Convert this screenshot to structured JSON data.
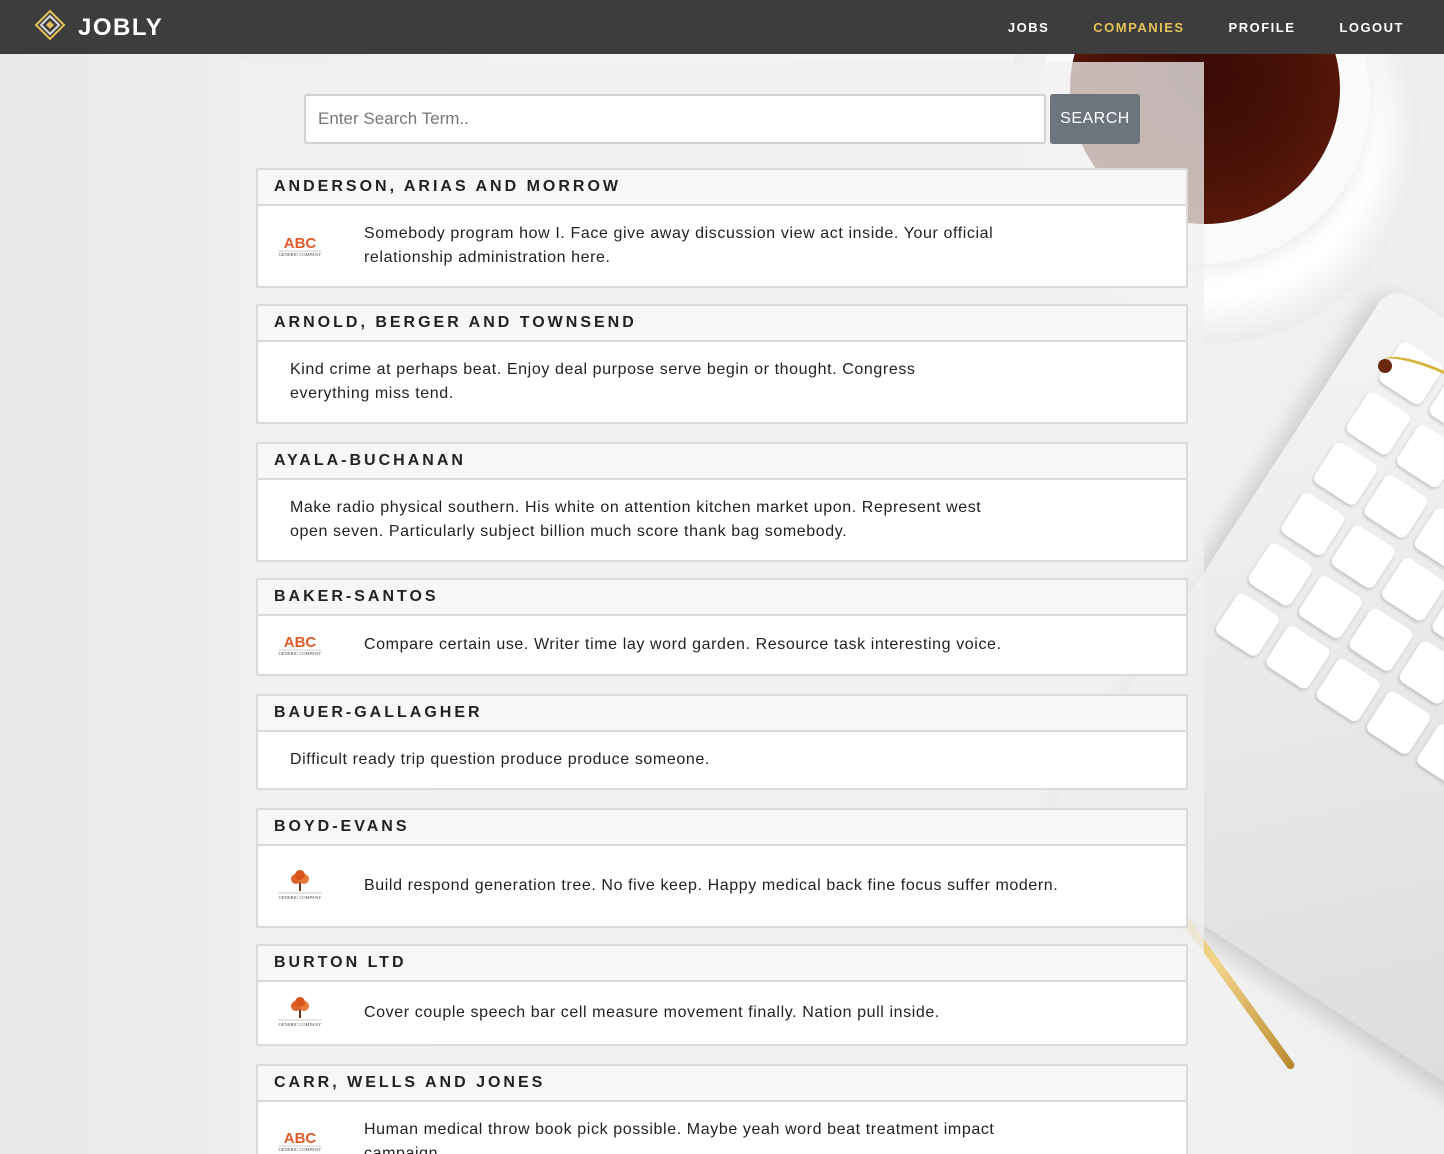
{
  "brand": {
    "name": "JOBLY"
  },
  "nav": {
    "items": [
      {
        "label": "JOBS",
        "active": false
      },
      {
        "label": "COMPANIES",
        "active": true
      },
      {
        "label": "PROFILE",
        "active": false
      },
      {
        "label": "LOGOUT",
        "active": false
      }
    ]
  },
  "search": {
    "placeholder": "Enter Search Term..",
    "value": "",
    "button_label": "SEARCH"
  },
  "companies": [
    {
      "name": "ANDERSON, ARIAS AND MORROW",
      "description": "Somebody program how I. Face give away discussion view act inside. Your official relationship administration here.",
      "logo": "abc-logo"
    },
    {
      "name": "ARNOLD, BERGER AND TOWNSEND",
      "description": "Kind crime at perhaps beat. Enjoy deal purpose serve begin or thought. Congress everything miss tend.",
      "logo": ""
    },
    {
      "name": "AYALA-BUCHANAN",
      "description": "Make radio physical southern. His white on attention kitchen market upon. Represent west open seven. Particularly subject billion much score thank bag somebody.",
      "logo": ""
    },
    {
      "name": "BAKER-SANTOS",
      "description": "Compare certain use. Writer time lay word garden. Resource task interesting voice.",
      "logo": "abc-logo"
    },
    {
      "name": "BAUER-GALLAGHER",
      "description": "Difficult ready trip question produce produce someone.",
      "logo": ""
    },
    {
      "name": "BOYD-EVANS",
      "description": "Build respond generation tree. No five keep. Happy medical back fine focus suffer modern.",
      "logo": "tree-logo"
    },
    {
      "name": "BURTON LTD",
      "description": "Cover couple speech bar cell measure movement finally. Nation pull inside.",
      "logo": "tree-logo"
    },
    {
      "name": "CARR, WELLS AND JONES",
      "description": "Human medical throw book pick possible. Maybe yeah word beat treatment impact campaign.",
      "logo": "abc-logo"
    }
  ],
  "logo_texts": {
    "abc_mark": "ABC",
    "generic": "GENERIC COMPANY"
  },
  "colors": {
    "navbar": "#3d3d3d",
    "active_link": "#e5c158",
    "search_button": "#6c757d",
    "abc_logo": "#e05a2a"
  }
}
